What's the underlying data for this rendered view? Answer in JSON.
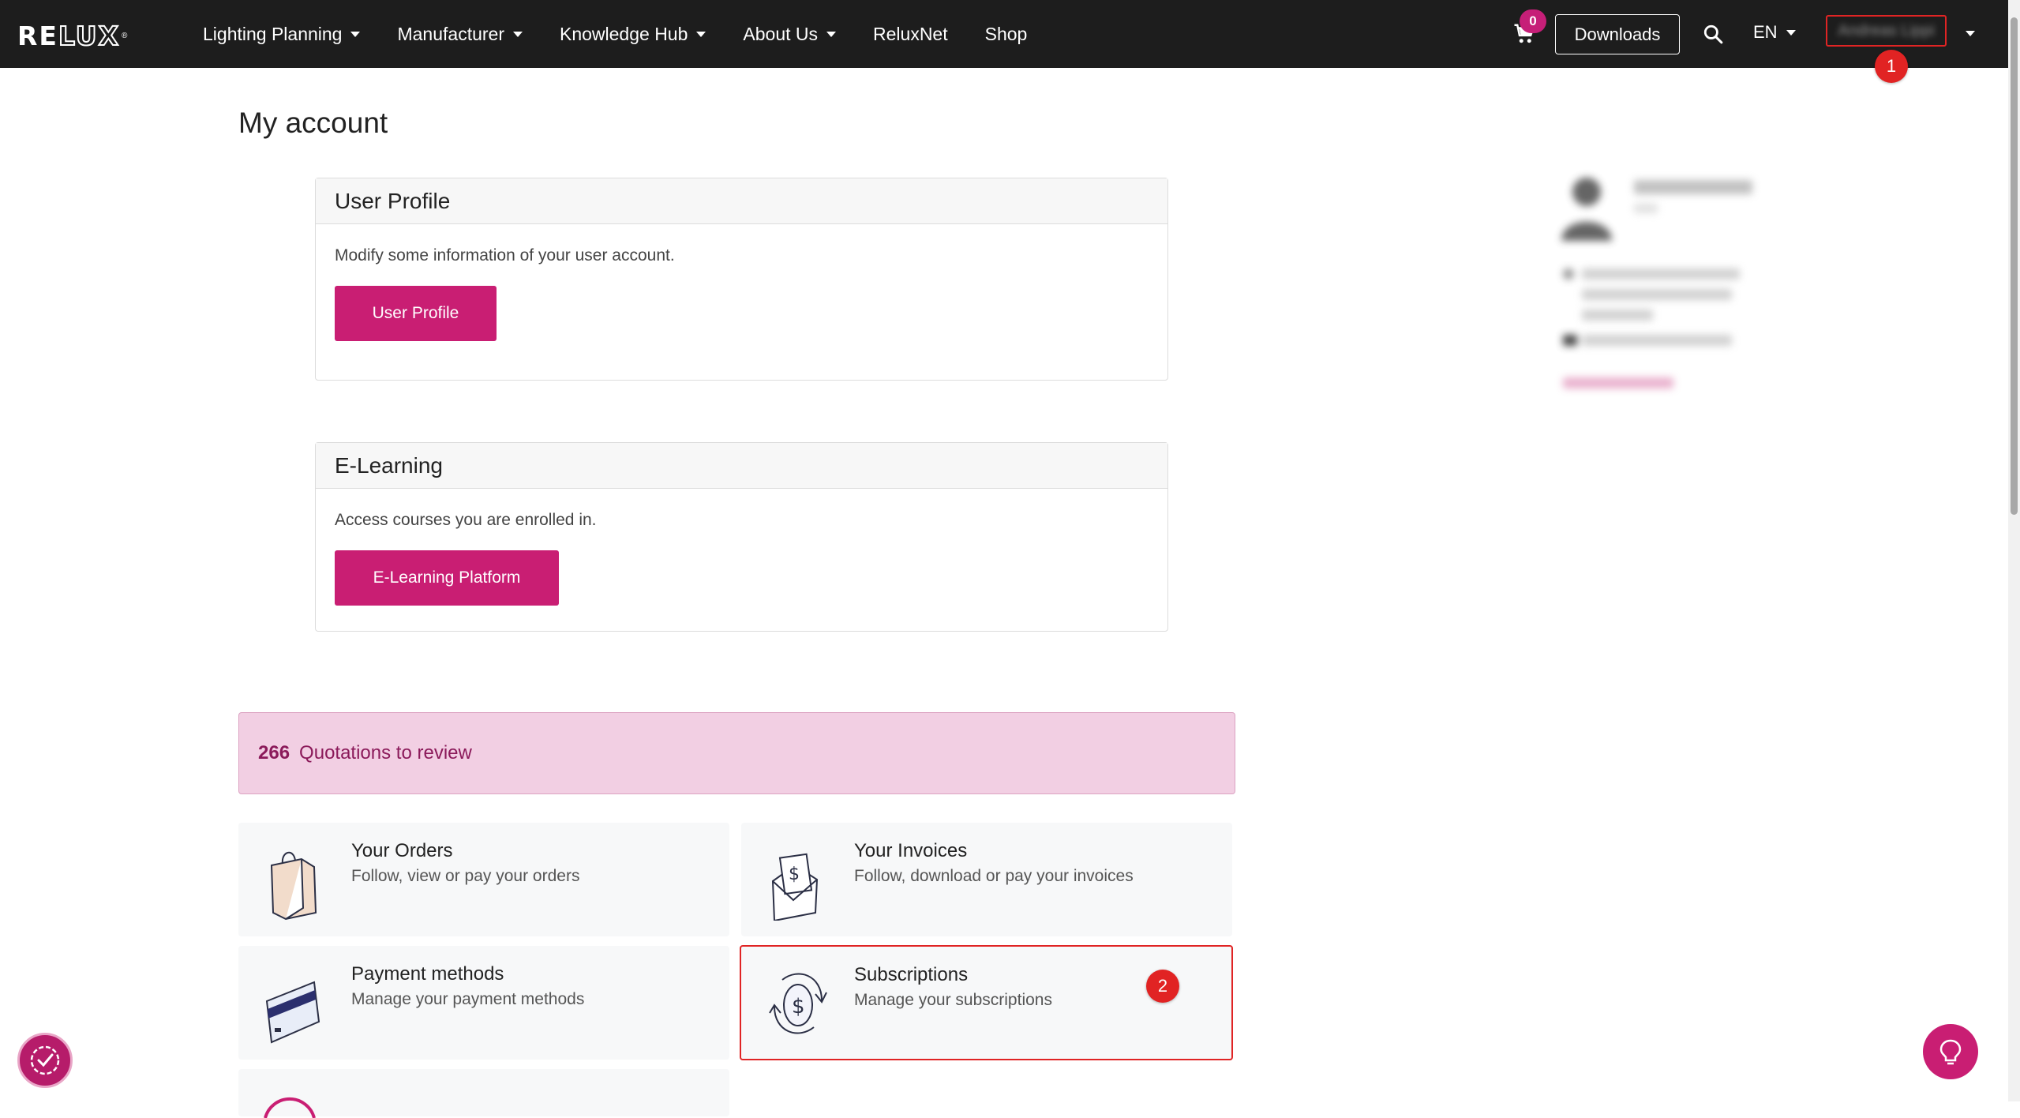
{
  "nav": {
    "brand": "RELUX",
    "items": [
      {
        "label": "Lighting Planning",
        "has_dropdown": true
      },
      {
        "label": "Manufacturer",
        "has_dropdown": true
      },
      {
        "label": "Knowledge Hub",
        "has_dropdown": true
      },
      {
        "label": "About Us",
        "has_dropdown": true
      },
      {
        "label": "ReluxNet",
        "has_dropdown": false
      },
      {
        "label": "Shop",
        "has_dropdown": false
      }
    ],
    "cart_count": "0",
    "downloads_label": "Downloads",
    "language": "EN",
    "user_name": "Andreas Lippi"
  },
  "markers": {
    "user_menu": "1",
    "subscriptions": "2"
  },
  "page": {
    "title": "My account"
  },
  "cards": {
    "profile": {
      "title": "User Profile",
      "text": "Modify some information of your user account.",
      "button": "User Profile"
    },
    "elearning": {
      "title": "E-Learning",
      "text": "Access courses you are enrolled in.",
      "button": "E-Learning Platform"
    }
  },
  "alert": {
    "count": "266",
    "text": "Quotations to review"
  },
  "tiles": {
    "orders": {
      "title": "Your Orders",
      "subtitle": "Follow, view or pay your orders",
      "icon": "shopping-bag-icon"
    },
    "invoices": {
      "title": "Your Invoices",
      "subtitle": "Follow, download or pay your invoices",
      "icon": "invoice-envelope-icon"
    },
    "payment": {
      "title": "Payment methods",
      "subtitle": "Manage your payment methods",
      "icon": "credit-card-icon"
    },
    "subscriptions": {
      "title": "Subscriptions",
      "subtitle": "Manage your subscriptions",
      "icon": "subscription-cycle-icon"
    }
  },
  "colors": {
    "navbar": "#1d1d1d",
    "brand_pink": "#c91e73",
    "alert_bg": "#f2cfe3",
    "alert_text": "#8b1a5a",
    "annotation_red": "#e02424"
  }
}
